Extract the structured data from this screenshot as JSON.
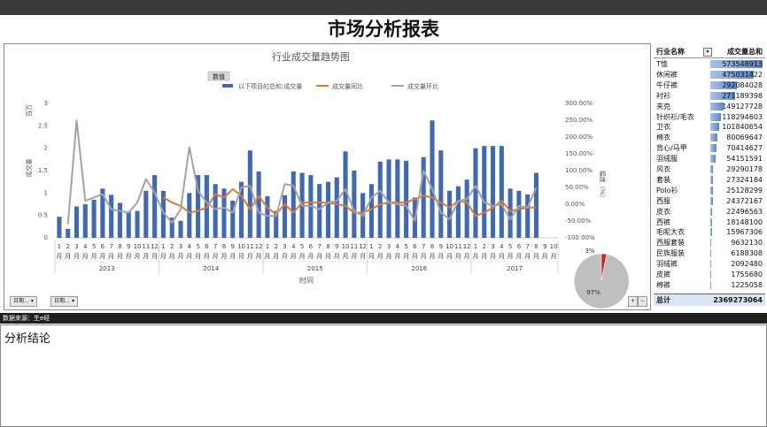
{
  "page": {
    "title": "市场分析报表",
    "source": "数据来源：生e经",
    "conclusion_label": "分析结论"
  },
  "filters": [
    {
      "label": "日期…"
    },
    {
      "label": "日期…"
    }
  ],
  "chart_data": [
    {
      "type": "bar+line",
      "title": "行业成交量趋势图",
      "badge": "数值",
      "ylabel_left": "成交量",
      "unit_left": "百万",
      "ylabel_right": "幅度（%）",
      "xlabel": "时间",
      "ylim_left": [
        0,
        3
      ],
      "yticks_left": [
        "0",
        "0.5",
        "1",
        "1.5",
        "2",
        "2.5",
        "3"
      ],
      "ylim_right": [
        -100,
        300
      ],
      "yticks_right": [
        "-100.00%",
        "-50.00%",
        "0.00%",
        "50.00%",
        "100.00%",
        "150.00%",
        "200.00%",
        "250.00%",
        "300.00%"
      ],
      "years": [
        "2013",
        "2014",
        "2015",
        "2016",
        "2017"
      ],
      "months": [
        "1",
        "2",
        "3",
        "4",
        "5",
        "6",
        "7",
        "8",
        "9",
        "10",
        "11",
        "12",
        "1",
        "2",
        "3",
        "4",
        "5",
        "6",
        "7",
        "8",
        "9",
        "10",
        "11",
        "12",
        "1",
        "2",
        "3",
        "4",
        "5",
        "6",
        "7",
        "8",
        "9",
        "10",
        "11",
        "12",
        "1",
        "2",
        "3",
        "4",
        "5",
        "6",
        "7",
        "8",
        "9",
        "10",
        "11",
        "12",
        "1",
        "2",
        "3",
        "4",
        "5",
        "6",
        "7",
        "8",
        "9",
        "10"
      ],
      "month_suffix": "月",
      "series": [
        {
          "name": "以下项目的总和:成交量",
          "kind": "bar",
          "color": "#3f69b3",
          "values": [
            0.47,
            0.2,
            0.7,
            0.75,
            0.85,
            1.1,
            0.96,
            0.78,
            0.58,
            0.6,
            1.05,
            1.4,
            1.05,
            0.45,
            0.38,
            1.0,
            1.4,
            1.4,
            1.2,
            1.1,
            0.83,
            1.25,
            1.95,
            1.48,
            0.93,
            0.6,
            0.95,
            1.48,
            1.45,
            1.4,
            1.2,
            1.25,
            1.35,
            1.93,
            1.5,
            1.0,
            1.2,
            1.7,
            1.75,
            1.75,
            1.72,
            0.9,
            1.8,
            2.62,
            1.95,
            1.05,
            1.15,
            1.3,
            2.0,
            2.05,
            2.05,
            2.05,
            1.1,
            1.05,
            0.97,
            1.45
          ]
        },
        {
          "name": "成交量同比",
          "kind": "line",
          "color": "#e07b2b",
          "values": [
            null,
            null,
            null,
            null,
            null,
            null,
            null,
            null,
            null,
            null,
            null,
            null,
            20,
            5,
            -5,
            -25,
            -20,
            -10,
            30,
            20,
            45,
            25,
            -15,
            25,
            -10,
            -30,
            0,
            -25,
            5,
            5,
            5,
            5,
            0,
            -5,
            -25,
            -25,
            -15,
            0,
            5,
            5,
            5,
            15,
            25,
            20,
            5,
            -10,
            10,
            5,
            -35,
            -25,
            -10,
            10,
            -20,
            -15,
            -10,
            -10
          ]
        },
        {
          "name": "成交量环比",
          "kind": "line",
          "color": "#a3a3a3",
          "values": [
            null,
            -60,
            250,
            10,
            20,
            30,
            -15,
            -20,
            -25,
            5,
            75,
            35,
            -25,
            -55,
            -15,
            170,
            40,
            5,
            -15,
            -10,
            -25,
            50,
            55,
            -25,
            -35,
            -35,
            60,
            55,
            -5,
            -5,
            -15,
            5,
            10,
            45,
            -20,
            -35,
            20,
            40,
            5,
            0,
            -5,
            -50,
            100,
            45,
            -25,
            -45,
            10,
            15,
            55,
            5,
            -5,
            0,
            -45,
            -5,
            -10,
            50
          ]
        }
      ]
    },
    {
      "type": "pie",
      "values": [
        97,
        3
      ],
      "labels": [
        "97%",
        "3%"
      ],
      "colors": [
        "#bfbfbf",
        "#c72020"
      ]
    }
  ],
  "ranking": {
    "header_name": "行业名称",
    "header_value": "成交量总和",
    "max": 573548913,
    "rows": [
      {
        "name": "T恤",
        "value": 573548913,
        "label": "573548913"
      },
      {
        "name": "休闲裤",
        "value": 475031422,
        "label": "475031422"
      },
      {
        "name": "牛仔裤",
        "value": 292084028,
        "label": "292084028"
      },
      {
        "name": "衬衫",
        "value": 271189398,
        "label": "271189398"
      },
      {
        "name": "夹克",
        "value": 149127728,
        "label": "149127728"
      },
      {
        "name": "针织衫/毛衣",
        "value": 118294603,
        "label": "118294603"
      },
      {
        "name": "卫衣",
        "value": 101840654,
        "label": "101840654"
      },
      {
        "name": "棉衣",
        "value": 80069647,
        "label": "80069647"
      },
      {
        "name": "背心/马甲",
        "value": 70414627,
        "label": "70414627"
      },
      {
        "name": "羽绒服",
        "value": 54151591,
        "label": "54151591"
      },
      {
        "name": "风衣",
        "value": 29290178,
        "label": "29290178"
      },
      {
        "name": "套装",
        "value": 27324184,
        "label": "27324184"
      },
      {
        "name": "Polo衫",
        "value": 25128299,
        "label": "25128299"
      },
      {
        "name": "西服",
        "value": 24372167,
        "label": "24372167"
      },
      {
        "name": "皮衣",
        "value": 22496563,
        "label": "22496563"
      },
      {
        "name": "西裤",
        "value": 18148100,
        "label": "18148100"
      },
      {
        "name": "毛呢大衣",
        "value": 15967306,
        "label": "15967306"
      },
      {
        "name": "西服套装",
        "value": 9632130,
        "label": "9632130"
      },
      {
        "name": "民族服装",
        "value": 6188308,
        "label": "6188308"
      },
      {
        "name": "羽绒裤",
        "value": 2092480,
        "label": "2092480"
      },
      {
        "name": "皮裤",
        "value": 1755680,
        "label": "1755680"
      },
      {
        "name": "棉裤",
        "value": 1225058,
        "label": "1225058"
      }
    ],
    "total_label": "总计",
    "total_value": "2369273064"
  },
  "colors": {
    "bar": "#3f69b3",
    "yoy": "#e07b2b",
    "mom": "#a3a3a3",
    "pie_main": "#bfbfbf",
    "pie_slice": "#c72020"
  }
}
